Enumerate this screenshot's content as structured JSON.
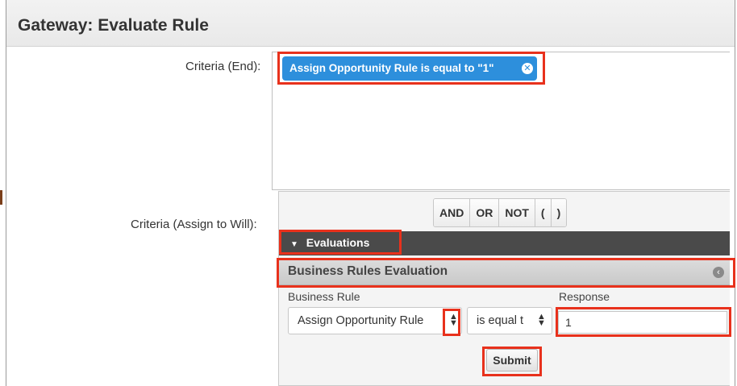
{
  "header": {
    "title": "Gateway: Evaluate Rule"
  },
  "form": {
    "criteria_end_label": "Criteria (End):",
    "criteria_assign_label": "Criteria (Assign to Will):",
    "criteria_pill_text": "Assign Opportunity Rule is equal to \"1\"",
    "pill_close_icon": "close-circle-icon"
  },
  "operators": [
    "AND",
    "OR",
    "NOT",
    "(",
    ")"
  ],
  "evaluations": {
    "section_title": "Evaluations",
    "subsection_title": "Business Rules Evaluation",
    "business_rule_label": "Business Rule",
    "response_label": "Response",
    "business_rule_value": "Assign Opportunity Rule",
    "operator_value": "is equal t",
    "response_value": "1",
    "submit_label": "Submit"
  },
  "colors": {
    "accent_blue": "#2d8fdc",
    "highlight_red": "#e8311c",
    "dark_bar": "#4a4a4a"
  }
}
